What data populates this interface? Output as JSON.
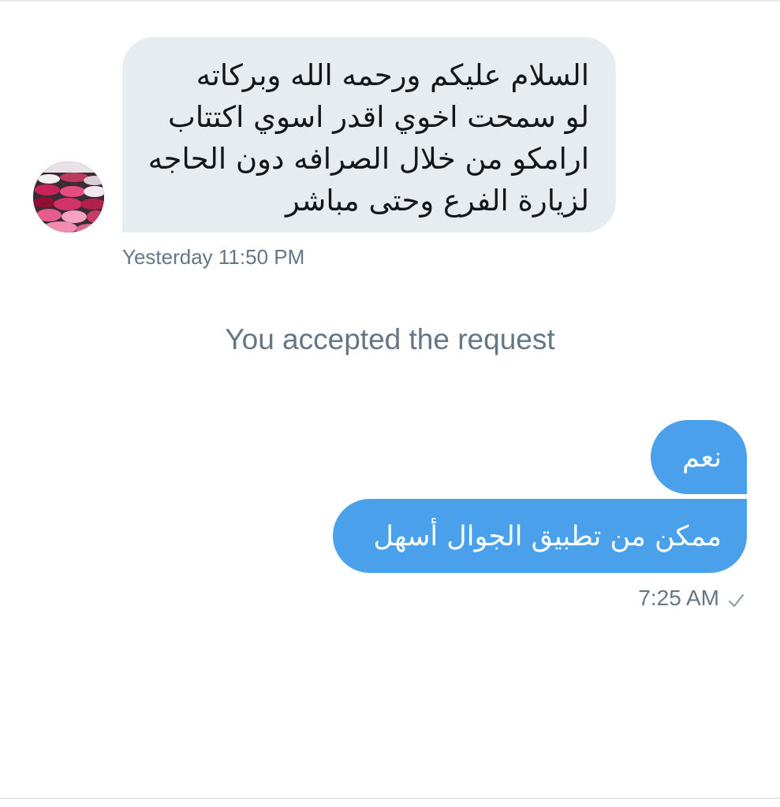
{
  "conversation": {
    "incoming_message": {
      "lines": [
        "السلام عليكم ورحمه الله وبركاته",
        "لو سمحت اخوي اقدر اسوي اكتتاب",
        "ارامكو من خلال الصرافه دون الحاجه",
        "لزيارة الفرع وحتى مباشر"
      ],
      "timestamp": "Yesterday 11:50 PM"
    },
    "system_message": "You accepted the request",
    "outgoing_messages": [
      {
        "text": "نعم"
      },
      {
        "text": "ممكن من تطبيق الجوال أسهل"
      }
    ],
    "outgoing_timestamp": "7:25 AM",
    "read_status_icon": "checkmark-icon"
  },
  "colors": {
    "incoming_bubble": "#e6ecf0",
    "outgoing_bubble": "#4aa1eb",
    "secondary_text": "#657786",
    "primary_text": "#14171a"
  }
}
